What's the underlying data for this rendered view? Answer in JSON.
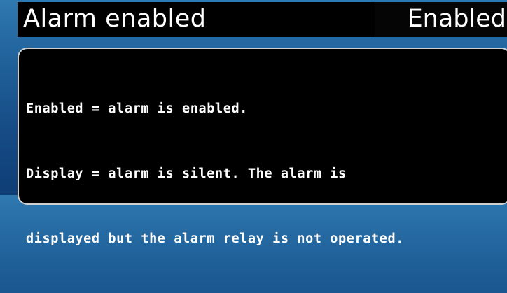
{
  "header": {
    "title": "Alarm enabled",
    "value": "Enabled"
  },
  "help": {
    "lines": [
      "Enabled = alarm is enabled.",
      "Display = alarm is silent. The alarm is",
      "displayed but the alarm relay is not operated."
    ]
  }
}
